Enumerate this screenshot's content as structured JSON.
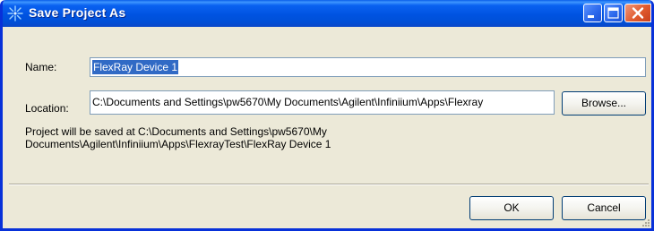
{
  "window": {
    "title": "Save Project As"
  },
  "name": {
    "label": "Name:",
    "value": "FlexRay Device 1"
  },
  "location": {
    "label": "Location:",
    "value": "C:\\Documents and Settings\\pw5670\\My Documents\\Agilent\\Infiniium\\Apps\\Flexray",
    "browse_label": "Browse..."
  },
  "info": {
    "line1": "Project will be saved at C:\\Documents and Settings\\pw5670\\My",
    "line2": "Documents\\Agilent\\Infiniium\\Apps\\FlexrayTest\\FlexRay Device 1"
  },
  "buttons": {
    "ok_label": "OK",
    "cancel_label": "Cancel"
  },
  "colors": {
    "titlebar": "#0054e3",
    "selection": "#316ac5",
    "dialog_bg": "#ece9d8"
  },
  "icons": {
    "title": "sparkle-icon",
    "minimize": "minimize-icon",
    "maximize": "maximize-icon",
    "close": "close-icon"
  }
}
